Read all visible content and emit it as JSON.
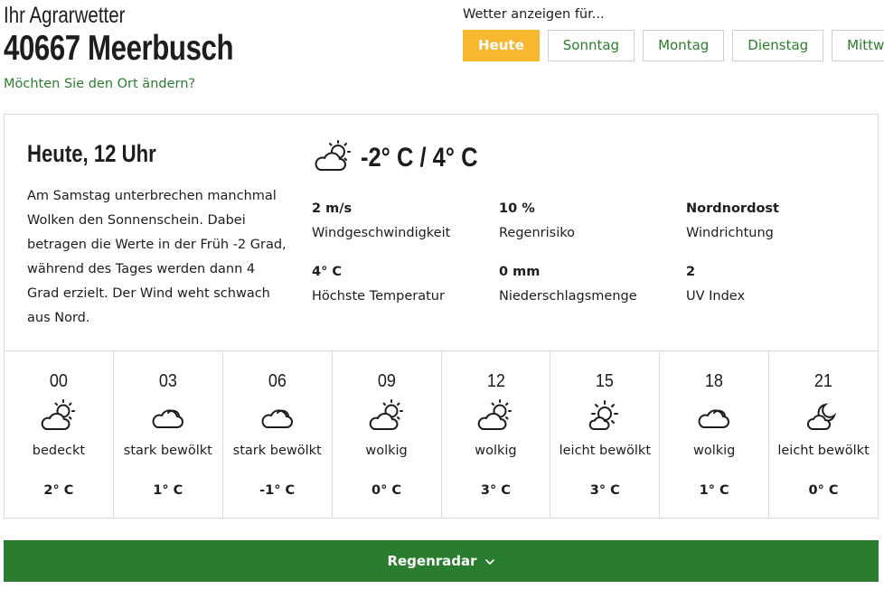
{
  "header": {
    "subtitle": "Ihr Agrarwetter",
    "location": "40667 Meerbusch",
    "change_location": "Möchten Sie den Ort ändern?"
  },
  "day_selector": {
    "label": "Wetter anzeigen für...",
    "tabs": [
      {
        "label": "Heute",
        "active": true
      },
      {
        "label": "Sonntag",
        "active": false
      },
      {
        "label": "Montag",
        "active": false
      },
      {
        "label": "Dienstag",
        "active": false
      },
      {
        "label": "Mittwoch",
        "active": false
      }
    ]
  },
  "current": {
    "title": "Heute, 12 Uhr",
    "description": "Am Samstag unterbrechen manchmal Wolken den Sonnenschein. Dabei betragen die Werte in der Früh -2 Grad, während des Tages werden dann 4 Grad erzielt. Der Wind weht schwach aus Nord.",
    "temperature_range": "-2° C / 4° C",
    "icon": "partly-cloudy-icon",
    "stats": [
      {
        "value": "2 m/s",
        "label": "Windgeschwindigkeit"
      },
      {
        "value": "10 %",
        "label": "Regenrisiko"
      },
      {
        "value": "Nordnordost",
        "label": "Windrichtung"
      },
      {
        "value": "4° C",
        "label": "Höchste Temperatur"
      },
      {
        "value": "0 mm",
        "label": "Niederschlagsmenge"
      },
      {
        "value": "2",
        "label": "UV Index"
      }
    ]
  },
  "hourly": [
    {
      "time": "00",
      "condition": "bedeckt",
      "temp": "2° C",
      "icon": "partly-cloudy-icon"
    },
    {
      "time": "03",
      "condition": "stark bewölkt",
      "temp": "1° C",
      "icon": "cloud-icon"
    },
    {
      "time": "06",
      "condition": "stark bewölkt",
      "temp": "-1° C",
      "icon": "cloud-icon"
    },
    {
      "time": "09",
      "condition": "wolkig",
      "temp": "0° C",
      "icon": "partly-cloudy-icon"
    },
    {
      "time": "12",
      "condition": "wolkig",
      "temp": "3° C",
      "icon": "partly-cloudy-icon"
    },
    {
      "time": "15",
      "condition": "leicht bewölkt",
      "temp": "3° C",
      "icon": "sun-cloud-icon"
    },
    {
      "time": "18",
      "condition": "wolkig",
      "temp": "1° C",
      "icon": "cloud-icon"
    },
    {
      "time": "21",
      "condition": "leicht bewölkt",
      "temp": "0° C",
      "icon": "moon-cloud-icon"
    }
  ],
  "radar_button": {
    "label": "Regenradar"
  },
  "colors": {
    "accent_green": "#2a7d2e",
    "active_tab": "#f7b82f"
  }
}
